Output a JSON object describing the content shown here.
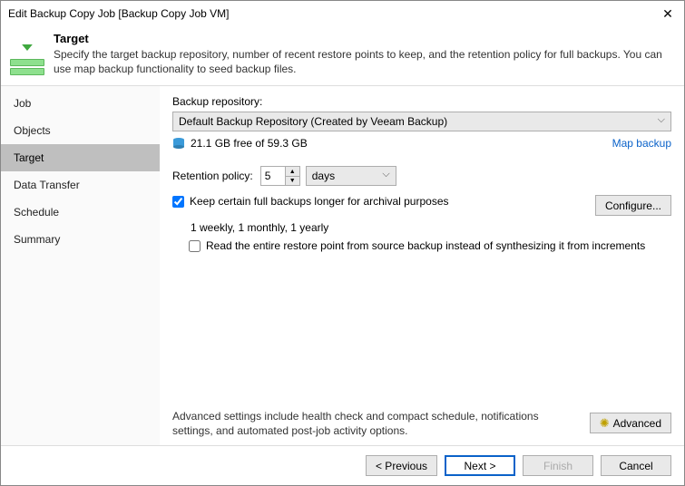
{
  "window": {
    "title": "Edit Backup Copy Job [Backup Copy Job VM]"
  },
  "header": {
    "title": "Target",
    "subtitle": "Specify the target backup repository, number of recent restore points to keep, and the retention policy for full backups. You can use map backup functionality to seed backup files."
  },
  "sidebar": {
    "steps": [
      "Job",
      "Objects",
      "Target",
      "Data Transfer",
      "Schedule",
      "Summary"
    ],
    "active_index": 2
  },
  "content": {
    "repo_label": "Backup repository:",
    "repo_value": "Default Backup Repository (Created by Veeam Backup)",
    "repo_free": "21.1 GB free of 59.3 GB",
    "map_backup": "Map backup",
    "retention_label": "Retention policy:",
    "retention_value": "5",
    "retention_unit": "days",
    "keep_full_label": "Keep certain full backups longer for archival purposes",
    "keep_full_checked": true,
    "configure_btn": "Configure...",
    "gfs_summary": "1 weekly, 1 monthly, 1 yearly",
    "read_entire_label": "Read the entire restore point from source backup instead of synthesizing it from increments",
    "read_entire_checked": false,
    "advanced_text": "Advanced settings include health check and compact schedule, notifications settings, and automated post-job activity options.",
    "advanced_btn": "Advanced"
  },
  "footer": {
    "previous": "< Previous",
    "next": "Next >",
    "finish": "Finish",
    "cancel": "Cancel"
  }
}
